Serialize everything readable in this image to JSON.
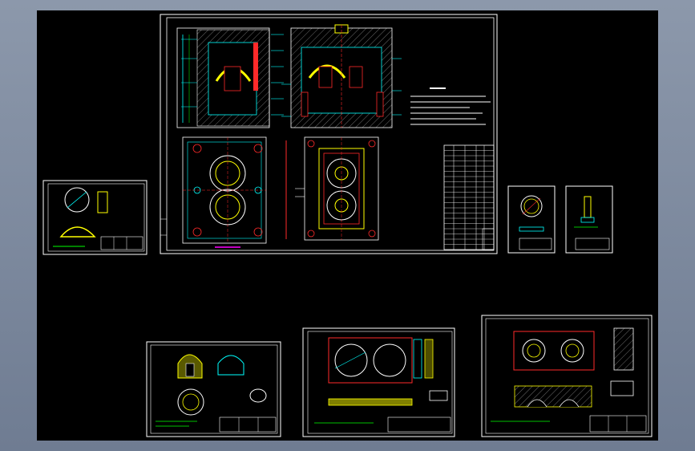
{
  "colors": {
    "background": "#000000",
    "border": "#ffffff",
    "cyan": "#00ffff",
    "red": "#ff2a2a",
    "yellow": "#ffff00",
    "green": "#00ff00",
    "magenta": "#ff00ff"
  },
  "sheets": [
    {
      "id": "main-assembly",
      "kind": "assembly"
    },
    {
      "id": "part-small-left",
      "kind": "part"
    },
    {
      "id": "part-small-right-a",
      "kind": "part"
    },
    {
      "id": "part-small-right-b",
      "kind": "part"
    },
    {
      "id": "part-bottom-left",
      "kind": "part"
    },
    {
      "id": "part-bottom-middle",
      "kind": "part"
    },
    {
      "id": "part-bottom-right",
      "kind": "part"
    }
  ]
}
